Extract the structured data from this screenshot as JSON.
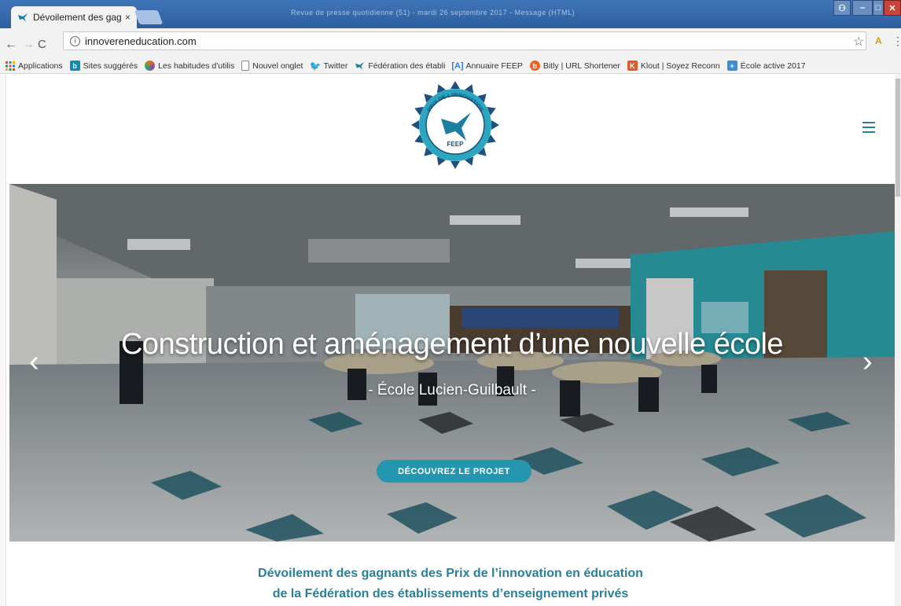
{
  "browser": {
    "tab_title": "Dévoilement des gagnan",
    "tab_close": "×",
    "blurred_window_title": "Revue de presse quotidienne (51) - mardi 26 septembre 2017 - Message (HTML)",
    "url": "innovereneducation.com",
    "bookmarks": [
      {
        "label": "Applications",
        "icon": "apps-grid-icon",
        "color": "#e44d26"
      },
      {
        "label": "Sites suggérés",
        "icon": "bing-icon",
        "color": "#138ab5"
      },
      {
        "label": "Les habitudes d'utilis",
        "icon": "colorwheel-icon",
        "color": "#e66d1c"
      },
      {
        "label": "Nouvel onglet",
        "icon": "page-icon",
        "color": "#ffffff"
      },
      {
        "label": "Twitter",
        "icon": "twitter-icon",
        "color": "#1da1f2"
      },
      {
        "label": "Fédération des établi",
        "icon": "feep-icon",
        "color": "#1d7fa0"
      },
      {
        "label": "Annuaire FEEP",
        "icon": "bracket-a-icon",
        "color": "#3a7ecf"
      },
      {
        "label": "Bitly | URL Shortener",
        "icon": "bitly-icon",
        "color": "#ee6123"
      },
      {
        "label": "Klout | Soyez Reconn",
        "icon": "klout-icon",
        "color": "#e25a29"
      },
      {
        "label": "École active 2017",
        "icon": "plus-square-icon",
        "color": "#3b8fd6"
      }
    ]
  },
  "site": {
    "logo_text_top": "PRIX DE L'INNOVATION",
    "logo_text_bottom": "FEEP",
    "hero_title": "Construction et aménagement d’une nouvelle école",
    "hero_subtitle": "- École Lucien-Guilbault -",
    "hero_cta": "DÉCOUVREZ LE PROJET",
    "arrow_left": "‹",
    "arrow_right": "›",
    "announce_line1": "Dévoilement des gagnants des Prix de l’innovation en éducation",
    "announce_line2": "de la Fédération des établissements d’enseignement privés"
  },
  "colors": {
    "accent": "#2497ae",
    "heading": "#2a7f9a"
  }
}
